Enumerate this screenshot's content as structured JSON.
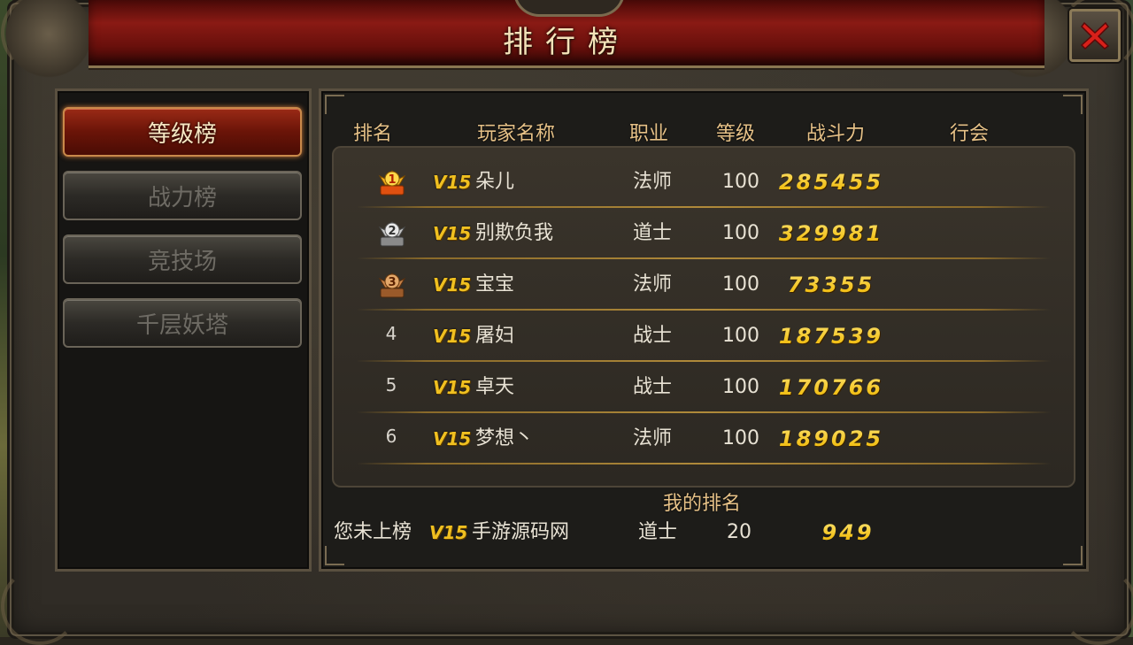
{
  "window": {
    "title": "排行榜",
    "close_icon": "close-x-icon"
  },
  "tabs": [
    {
      "label": "等级榜",
      "active": true
    },
    {
      "label": "战力榜",
      "active": false
    },
    {
      "label": "竞技场",
      "active": false
    },
    {
      "label": "千层妖塔",
      "active": false
    }
  ],
  "table": {
    "columns": {
      "rank": "排名",
      "name": "玩家名称",
      "job": "职业",
      "level": "等级",
      "power": "战斗力",
      "guild": "行会"
    },
    "rows": [
      {
        "rank": "1",
        "medal": "gold-medal-icon",
        "vip": "V15",
        "name": "朵儿",
        "job": "法师",
        "level": "100",
        "power": "285455",
        "guild": ""
      },
      {
        "rank": "2",
        "medal": "silver-medal-icon",
        "vip": "V15",
        "name": "别欺负我",
        "job": "道士",
        "level": "100",
        "power": "329981",
        "guild": ""
      },
      {
        "rank": "3",
        "medal": "bronze-medal-icon",
        "vip": "V15",
        "name": "宝宝",
        "job": "法师",
        "level": "100",
        "power": "73355",
        "guild": ""
      },
      {
        "rank": "4",
        "medal": "",
        "vip": "V15",
        "name": "屠妇",
        "job": "战士",
        "level": "100",
        "power": "187539",
        "guild": ""
      },
      {
        "rank": "5",
        "medal": "",
        "vip": "V15",
        "name": "卓天",
        "job": "战士",
        "level": "100",
        "power": "170766",
        "guild": ""
      },
      {
        "rank": "6",
        "medal": "",
        "vip": "V15",
        "name": "梦想丶",
        "job": "法师",
        "level": "100",
        "power": "189025",
        "guild": ""
      }
    ]
  },
  "my_rank": {
    "title": "我的排名",
    "status": "您未上榜",
    "vip": "V15",
    "name": "手游源码网",
    "job": "道士",
    "level": "20",
    "power": "949"
  },
  "colors": {
    "accent_gold": "#f0c020",
    "header_text": "#e6c187",
    "title_bar_red": "#8a1a14"
  }
}
